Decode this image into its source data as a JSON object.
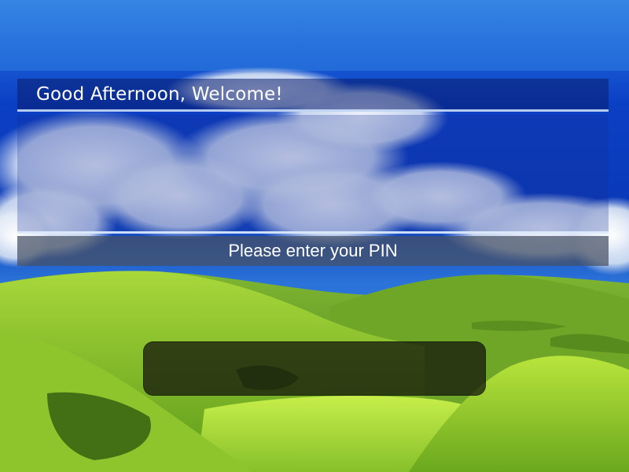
{
  "login": {
    "greeting": "Good Afternoon, Welcome!",
    "prompt": "Please enter your PIN",
    "pin": {
      "value": "",
      "placeholder": ""
    }
  },
  "colors": {
    "header_bg": "#0a1e6e",
    "prompt_bg": "#465064",
    "pin_bg": "#0f0f0a",
    "text": "#ffffff"
  }
}
